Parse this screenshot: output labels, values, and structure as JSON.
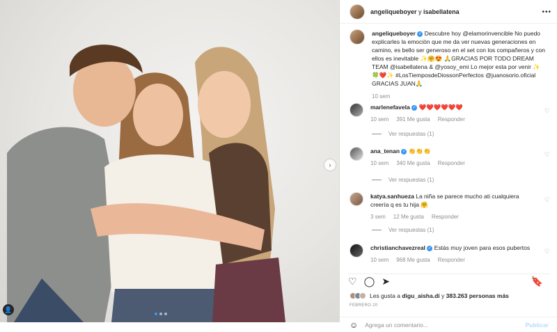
{
  "header": {
    "user1": "angeliqueboyer",
    "joiner": "y",
    "user2": "isabellatena"
  },
  "caption": {
    "username": "angeliqueboyer",
    "text": "Descubre hoy @elamorinvencible No puedo explicarles la emoción que me da ver nuevas generaciones en camino, es bello ser generoso en el set con los compañeros y con ellos es inevitable ✨🤗😍 🙏GRACIAS POR TODO DREAM TEAM @isabellatena & @yosoy_emi Lo mejor esta por venir ✨🍀❤️✨ #LosTiemposdeDiossonPerfectos @juanosorio.oficial GRACIAS JUAN🙏",
    "time": "10 sem"
  },
  "comments": [
    {
      "username": "marlenefavela",
      "verified": true,
      "text": "❤️❤️❤️❤️❤️❤️",
      "time": "10 sem",
      "likes": "391 Me gusta",
      "reply": "Responder",
      "replies": "Ver respuestas (1)"
    },
    {
      "username": "ana_tenan",
      "verified": true,
      "text": "👏👏👏",
      "time": "10 sem",
      "likes": "340 Me gusta",
      "reply": "Responder",
      "replies": "Ver respuestas (1)"
    },
    {
      "username": "katya.sanhueza",
      "verified": false,
      "text": "La niña se parece mucho ati cualquiera creería q es tu hija 🤗",
      "time": "3 sem",
      "likes": "12 Me gusta",
      "reply": "Responder",
      "replies": "Ver respuestas (1)"
    },
    {
      "username": "christianchavezreal",
      "verified": true,
      "text": "Estás muy joven para esos pubertos",
      "time": "10 sem",
      "likes": "968 Me gusta",
      "reply": "Responder"
    }
  ],
  "likes": {
    "prefix": "Les gusta a",
    "user": "digu_aisha.di",
    "mid": "y",
    "count": "383.263 personas más"
  },
  "date": "FEBRERO 20",
  "add_comment": {
    "placeholder": "Agrega un comentario...",
    "post_label": "Publicar"
  },
  "icons": [
    "heart-icon",
    "comment-icon",
    "share-icon",
    "bookmark-icon",
    "emoji-icon",
    "chevron-right-icon",
    "tag-user-icon"
  ],
  "colors": {
    "link": "#00376b",
    "verified": "#3897f0",
    "muted": "#8e8e8e",
    "post_disabled": "#b3dbff"
  }
}
